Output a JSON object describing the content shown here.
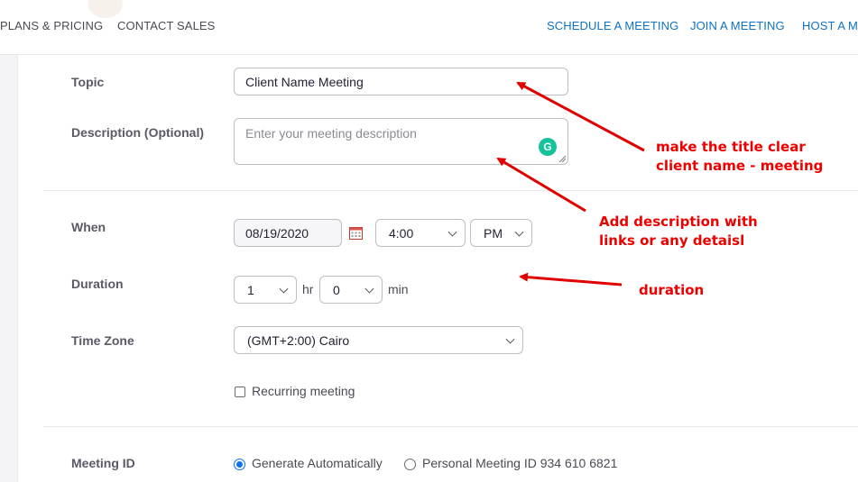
{
  "header": {
    "nav_left": [
      "PLANS & PRICING",
      "CONTACT SALES"
    ],
    "nav_right": [
      "SCHEDULE A MEETING",
      "JOIN A MEETING",
      "HOST A ME"
    ]
  },
  "form": {
    "topic": {
      "label": "Topic",
      "value": "Client Name Meeting"
    },
    "description": {
      "label": "Description (Optional)",
      "placeholder": "Enter your meeting description"
    },
    "when": {
      "label": "When",
      "date": "08/19/2020",
      "time": "4:00",
      "ampm": "PM"
    },
    "duration": {
      "label": "Duration",
      "hours": "1",
      "hours_unit": "hr",
      "minutes": "0",
      "minutes_unit": "min"
    },
    "timezone": {
      "label": "Time Zone",
      "value": "(GMT+2:00) Cairo"
    },
    "recurring": {
      "label": "Recurring meeting",
      "checked": false
    },
    "meeting_id": {
      "label": "Meeting ID",
      "option_auto": "Generate Automatically",
      "option_personal": "Personal Meeting ID 934 610 6821",
      "selected": "auto"
    }
  },
  "annotations": {
    "title_note_line1": "make the title clear",
    "title_note_line2": "client name - meeting",
    "desc_note_line1": "Add description with",
    "desc_note_line2": "links or any detaisl",
    "duration_note": "duration"
  },
  "colors": {
    "link": "#0e72c4",
    "annotation": "#ee0000",
    "radio": "#0e72ed",
    "grammarly": "#15c39a"
  }
}
